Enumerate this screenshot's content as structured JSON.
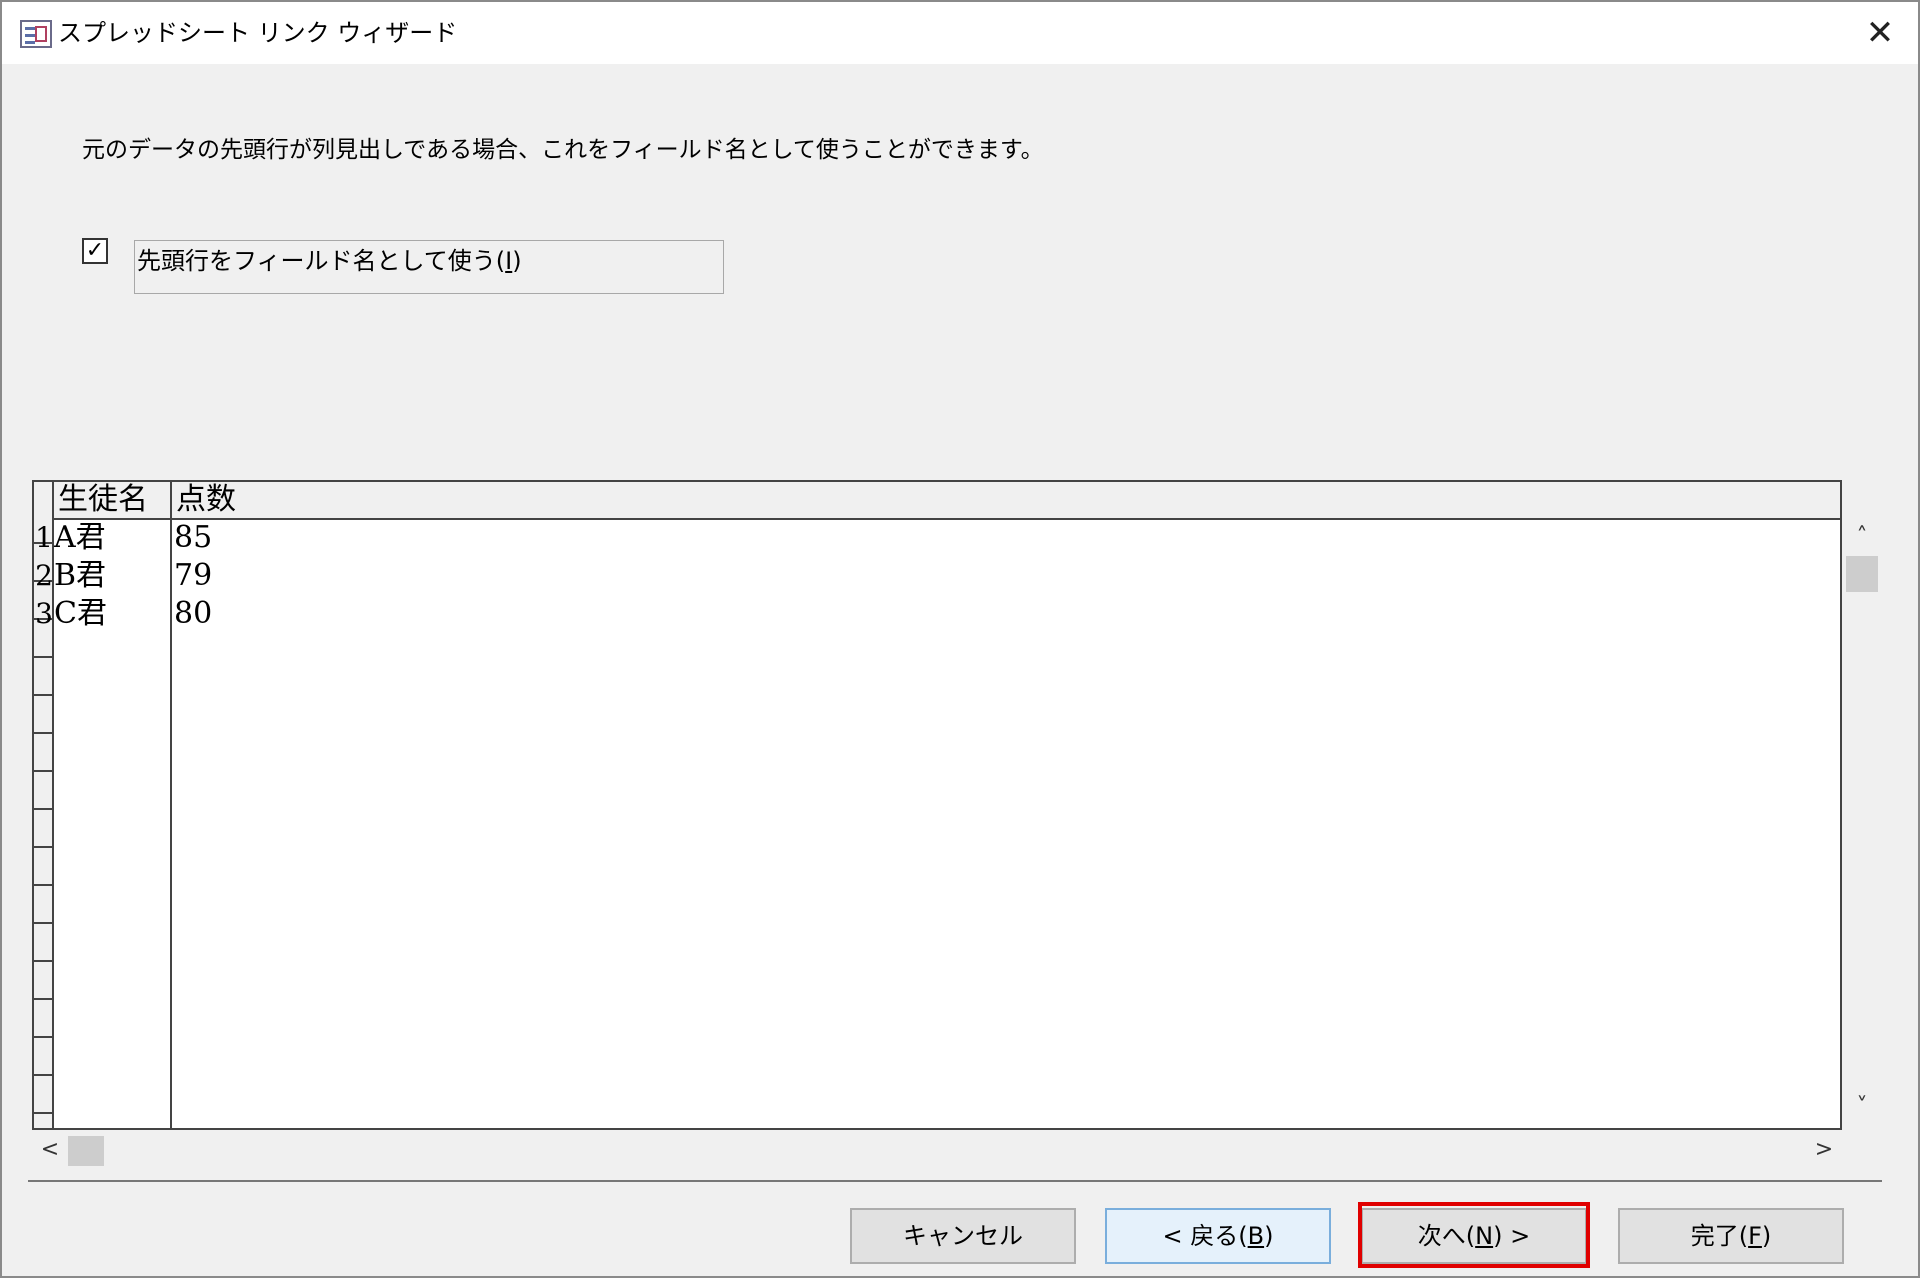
{
  "window": {
    "title": "スプレッドシート リンク ウィザード",
    "app_icon": "table-form-icon",
    "close_glyph": "✕"
  },
  "instruction": "元のデータの先頭行が列見出しである場合、これをフィールド名として使うことができます。",
  "checkbox": {
    "checked": true,
    "glyph": "✓",
    "label_before": "先頭行をフィールド名として使う(",
    "accel": "I",
    "label_after": ")"
  },
  "grid": {
    "headers": [
      "生徒名",
      "点数"
    ],
    "rows": [
      {
        "num": "1",
        "cells": [
          "A君",
          "85"
        ]
      },
      {
        "num": "2",
        "cells": [
          "B君",
          "79"
        ]
      },
      {
        "num": "3",
        "cells": [
          "C君",
          "80"
        ]
      }
    ]
  },
  "scroll": {
    "up": "˄",
    "down": "˅",
    "left": "<",
    "right": ">"
  },
  "buttons": {
    "cancel": {
      "label": "キャンセル"
    },
    "back": {
      "prefix": "< 戻る(",
      "accel": "B",
      "suffix": ")"
    },
    "next": {
      "prefix": "次へ(",
      "accel": "N",
      "suffix": ") >"
    },
    "finish": {
      "prefix": "完了(",
      "accel": "F",
      "suffix": ")"
    }
  },
  "colors": {
    "highlight": "#e00000",
    "default_button": "#e5f1fb"
  }
}
